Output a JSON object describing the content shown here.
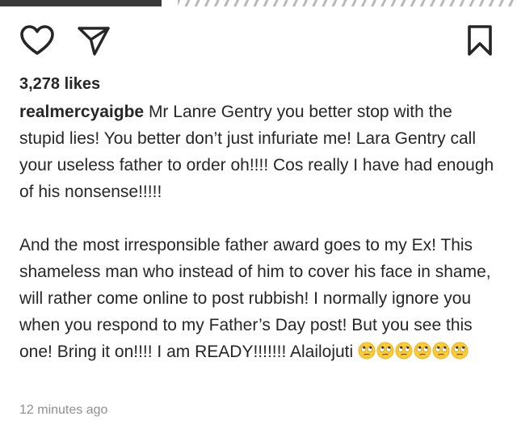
{
  "post": {
    "likes": "3,278 likes",
    "username": "realmercyaigbe",
    "caption_p1": " Mr Lanre Gentry you better stop with the stupid lies! You better don’t just infuriate me! Lara Gentry call your useless father to order oh!!!! Cos really I have had enough of his nonsense!!!!!",
    "caption_p2": "And the most irresponsible father award goes to my Ex! This shameless man who instead of him to cover his face in shame, will rather come online to post rubbish! I normally ignore you when you respond to my Father’s Day post! But you see this one! Bring it on!!!! I am READY!!!!!!! Alailojuti ",
    "emojis": [
      "face-with-rolling-eyes",
      "face-with-rolling-eyes",
      "face-with-rolling-eyes",
      "face-with-rolling-eyes",
      "face-with-rolling-eyes",
      "face-with-rolling-eyes"
    ],
    "timestamp": "12 minutes ago"
  },
  "icons": {
    "like": "heart-icon",
    "share": "paper-plane-icon",
    "save": "bookmark-icon"
  }
}
